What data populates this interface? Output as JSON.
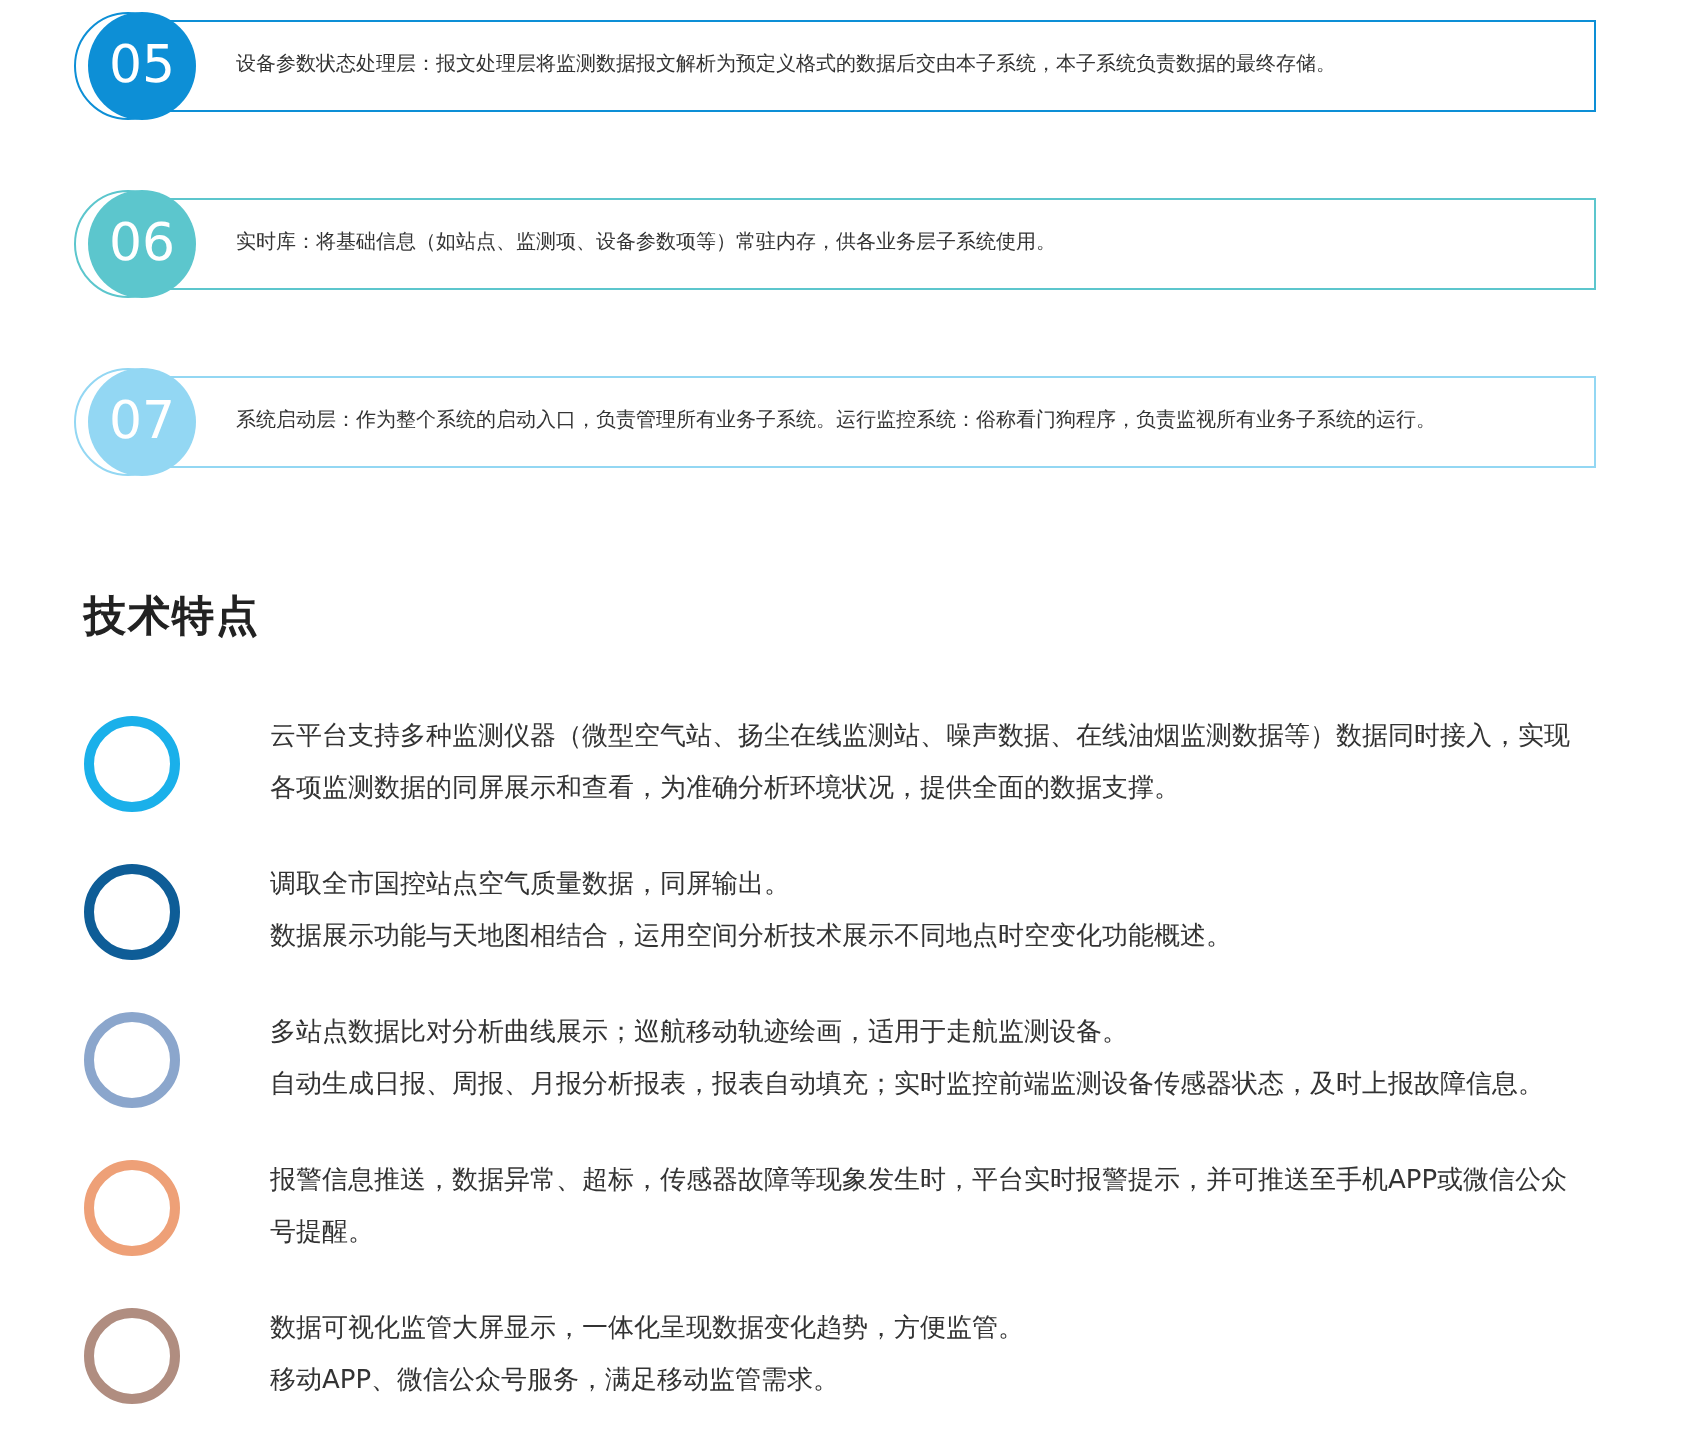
{
  "layers": [
    {
      "number": "05",
      "color": "#0d8fd6",
      "text": "设备参数状态处理层：报文处理层将监测数据报文解析为预定义格式的数据后交由本子系统，本子系统负责数据的最终存储。"
    },
    {
      "number": "06",
      "color": "#5cc6cd",
      "text": "实时库：将基础信息（如站点、监测项、设备参数项等）常驻内存，供各业务层子系统使用。"
    },
    {
      "number": "07",
      "color": "#93d7f3",
      "text": "系统启动层：作为整个系统的启动入口，负责管理所有业务子系统。运行监控系统：俗称看门狗程序，负责监视所有业务子系统的运行。"
    }
  ],
  "section_title": "技术特点",
  "features": [
    {
      "color": "#1ab0ea",
      "lines": [
        "云平台支持多种监测仪器（微型空气站、扬尘在线监测站、噪声数据、在线油烟监测数据等）数据同时接入，实现各项监测数据的同屏展示和查看，为准确分析环境状况，提供全面的数据支撑。"
      ]
    },
    {
      "color": "#0e5d97",
      "lines": [
        "调取全市国控站点空气质量数据，同屏输出。",
        "数据展示功能与天地图相结合，运用空间分析技术展示不同地点时空变化功能概述。"
      ]
    },
    {
      "color": "#8ba6cc",
      "lines": [
        "多站点数据比对分析曲线展示；巡航移动轨迹绘画，适用于走航监测设备。",
        "自动生成日报、周报、月报分析报表，报表自动填充；实时监控前端监测设备传感器状态，及时上报故障信息。"
      ]
    },
    {
      "color": "#eea077",
      "lines": [
        "报警信息推送，数据异常、超标，传感器故障等现象发生时，平台实时报警提示，并可推送至手机APP或微信公众号提醒。"
      ]
    },
    {
      "color": "#b08d80",
      "lines": [
        "数据可视化监管大屏显示，一体化呈现数据变化趋势，方便监管。",
        "移动APP、微信公众号服务，满足移动监管需求。"
      ]
    }
  ]
}
